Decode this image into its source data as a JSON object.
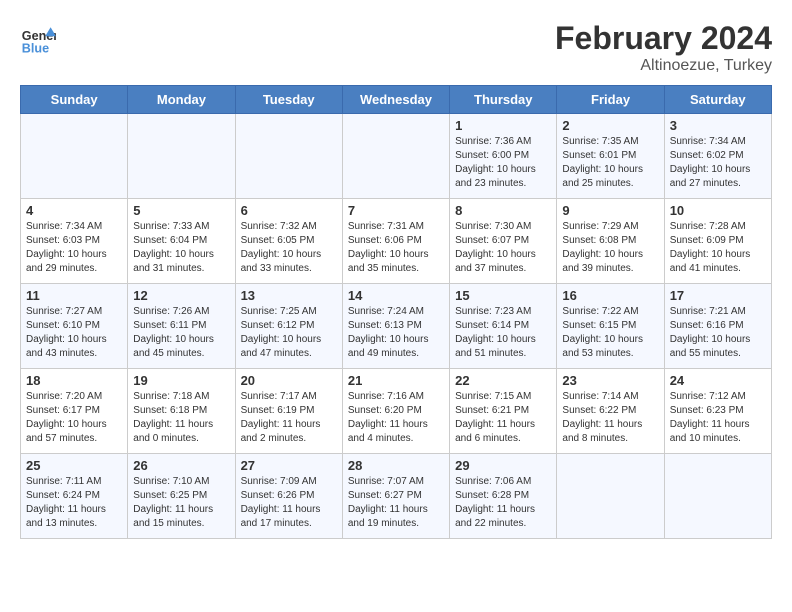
{
  "header": {
    "logo_line1": "General",
    "logo_line2": "Blue",
    "main_title": "February 2024",
    "sub_title": "Altinoezue, Turkey"
  },
  "days_of_week": [
    "Sunday",
    "Monday",
    "Tuesday",
    "Wednesday",
    "Thursday",
    "Friday",
    "Saturday"
  ],
  "weeks": [
    [
      {
        "day": "",
        "info": ""
      },
      {
        "day": "",
        "info": ""
      },
      {
        "day": "",
        "info": ""
      },
      {
        "day": "",
        "info": ""
      },
      {
        "day": "1",
        "info": "Sunrise: 7:36 AM\nSunset: 6:00 PM\nDaylight: 10 hours\nand 23 minutes."
      },
      {
        "day": "2",
        "info": "Sunrise: 7:35 AM\nSunset: 6:01 PM\nDaylight: 10 hours\nand 25 minutes."
      },
      {
        "day": "3",
        "info": "Sunrise: 7:34 AM\nSunset: 6:02 PM\nDaylight: 10 hours\nand 27 minutes."
      }
    ],
    [
      {
        "day": "4",
        "info": "Sunrise: 7:34 AM\nSunset: 6:03 PM\nDaylight: 10 hours\nand 29 minutes."
      },
      {
        "day": "5",
        "info": "Sunrise: 7:33 AM\nSunset: 6:04 PM\nDaylight: 10 hours\nand 31 minutes."
      },
      {
        "day": "6",
        "info": "Sunrise: 7:32 AM\nSunset: 6:05 PM\nDaylight: 10 hours\nand 33 minutes."
      },
      {
        "day": "7",
        "info": "Sunrise: 7:31 AM\nSunset: 6:06 PM\nDaylight: 10 hours\nand 35 minutes."
      },
      {
        "day": "8",
        "info": "Sunrise: 7:30 AM\nSunset: 6:07 PM\nDaylight: 10 hours\nand 37 minutes."
      },
      {
        "day": "9",
        "info": "Sunrise: 7:29 AM\nSunset: 6:08 PM\nDaylight: 10 hours\nand 39 minutes."
      },
      {
        "day": "10",
        "info": "Sunrise: 7:28 AM\nSunset: 6:09 PM\nDaylight: 10 hours\nand 41 minutes."
      }
    ],
    [
      {
        "day": "11",
        "info": "Sunrise: 7:27 AM\nSunset: 6:10 PM\nDaylight: 10 hours\nand 43 minutes."
      },
      {
        "day": "12",
        "info": "Sunrise: 7:26 AM\nSunset: 6:11 PM\nDaylight: 10 hours\nand 45 minutes."
      },
      {
        "day": "13",
        "info": "Sunrise: 7:25 AM\nSunset: 6:12 PM\nDaylight: 10 hours\nand 47 minutes."
      },
      {
        "day": "14",
        "info": "Sunrise: 7:24 AM\nSunset: 6:13 PM\nDaylight: 10 hours\nand 49 minutes."
      },
      {
        "day": "15",
        "info": "Sunrise: 7:23 AM\nSunset: 6:14 PM\nDaylight: 10 hours\nand 51 minutes."
      },
      {
        "day": "16",
        "info": "Sunrise: 7:22 AM\nSunset: 6:15 PM\nDaylight: 10 hours\nand 53 minutes."
      },
      {
        "day": "17",
        "info": "Sunrise: 7:21 AM\nSunset: 6:16 PM\nDaylight: 10 hours\nand 55 minutes."
      }
    ],
    [
      {
        "day": "18",
        "info": "Sunrise: 7:20 AM\nSunset: 6:17 PM\nDaylight: 10 hours\nand 57 minutes."
      },
      {
        "day": "19",
        "info": "Sunrise: 7:18 AM\nSunset: 6:18 PM\nDaylight: 11 hours\nand 0 minutes."
      },
      {
        "day": "20",
        "info": "Sunrise: 7:17 AM\nSunset: 6:19 PM\nDaylight: 11 hours\nand 2 minutes."
      },
      {
        "day": "21",
        "info": "Sunrise: 7:16 AM\nSunset: 6:20 PM\nDaylight: 11 hours\nand 4 minutes."
      },
      {
        "day": "22",
        "info": "Sunrise: 7:15 AM\nSunset: 6:21 PM\nDaylight: 11 hours\nand 6 minutes."
      },
      {
        "day": "23",
        "info": "Sunrise: 7:14 AM\nSunset: 6:22 PM\nDaylight: 11 hours\nand 8 minutes."
      },
      {
        "day": "24",
        "info": "Sunrise: 7:12 AM\nSunset: 6:23 PM\nDaylight: 11 hours\nand 10 minutes."
      }
    ],
    [
      {
        "day": "25",
        "info": "Sunrise: 7:11 AM\nSunset: 6:24 PM\nDaylight: 11 hours\nand 13 minutes."
      },
      {
        "day": "26",
        "info": "Sunrise: 7:10 AM\nSunset: 6:25 PM\nDaylight: 11 hours\nand 15 minutes."
      },
      {
        "day": "27",
        "info": "Sunrise: 7:09 AM\nSunset: 6:26 PM\nDaylight: 11 hours\nand 17 minutes."
      },
      {
        "day": "28",
        "info": "Sunrise: 7:07 AM\nSunset: 6:27 PM\nDaylight: 11 hours\nand 19 minutes."
      },
      {
        "day": "29",
        "info": "Sunrise: 7:06 AM\nSunset: 6:28 PM\nDaylight: 11 hours\nand 22 minutes."
      },
      {
        "day": "",
        "info": ""
      },
      {
        "day": "",
        "info": ""
      }
    ]
  ]
}
